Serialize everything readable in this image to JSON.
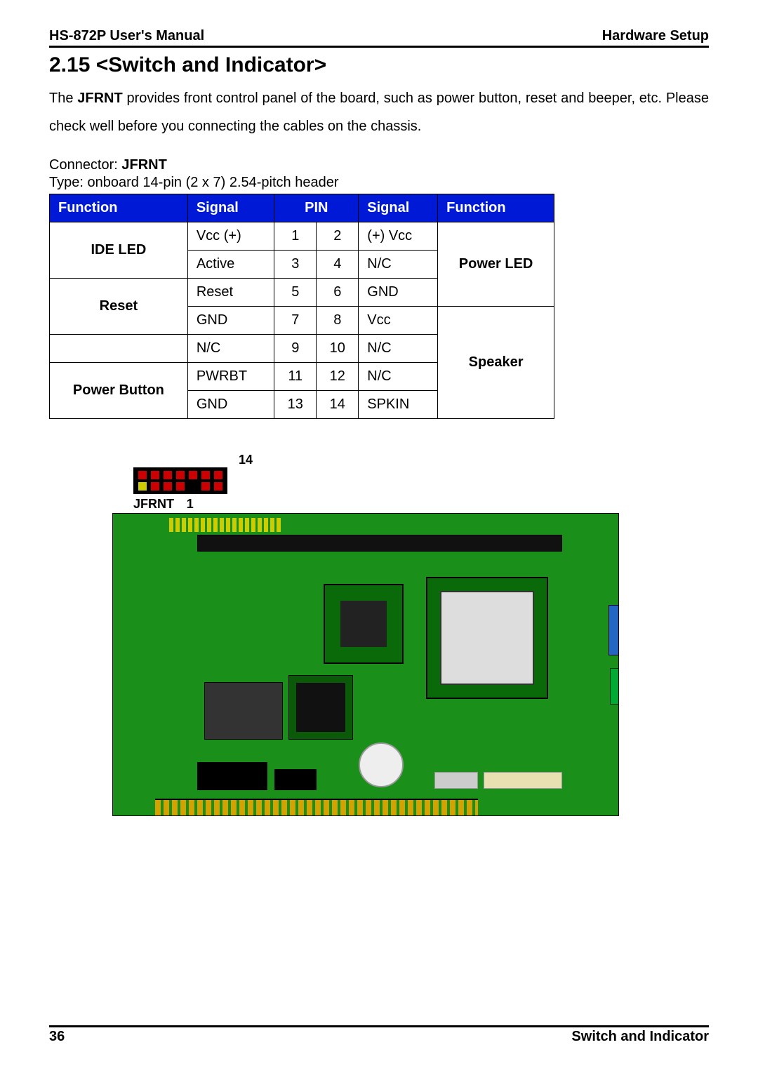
{
  "header": {
    "left": "HS-872P User's Manual",
    "right": "Hardware Setup"
  },
  "section": {
    "title": "2.15 <Switch and Indicator>",
    "text_prefix": "The ",
    "text_bold": "JFRNT",
    "text_suffix": " provides front control panel of the board, such as power button, reset and beeper, etc. Please check well before you connecting the cables on the chassis."
  },
  "connector": {
    "label": "Connector: ",
    "name": "JFRNT",
    "type": "Type: onboard 14-pin (2 x 7) 2.54-pitch header"
  },
  "table": {
    "headers": [
      "Function",
      "Signal",
      "PIN",
      "Signal",
      "Function"
    ],
    "rows": [
      {
        "func_l": "IDE LED",
        "sig_l": "Vcc  (+)",
        "pin_l": "1",
        "pin_r": "2",
        "sig_r": "(+) Vcc",
        "func_r": "Power LED"
      },
      {
        "sig_l": "Active",
        "pin_l": "3",
        "pin_r": "4",
        "sig_r": "N/C"
      },
      {
        "func_l": "Reset",
        "sig_l": "Reset",
        "pin_l": "5",
        "pin_r": "6",
        "sig_r": "GND"
      },
      {
        "sig_l": "GND",
        "pin_l": "7",
        "pin_r": "8",
        "sig_r": "Vcc",
        "func_r": "Speaker"
      },
      {
        "func_l": "",
        "sig_l": "N/C",
        "pin_l": "9",
        "pin_r": "10",
        "sig_r": "N/C"
      },
      {
        "func_l": "Power Button",
        "sig_l": "PWRBT",
        "pin_l": "11",
        "pin_r": "12",
        "sig_r": "N/C"
      },
      {
        "sig_l": "GND",
        "pin_l": "13",
        "pin_r": "14",
        "sig_r": "SPKIN"
      }
    ]
  },
  "callout": {
    "top_label": "14",
    "name": "JFRNT",
    "bottom_label": "1"
  },
  "footer": {
    "page": "36",
    "title": "Switch  and  Indicator"
  }
}
